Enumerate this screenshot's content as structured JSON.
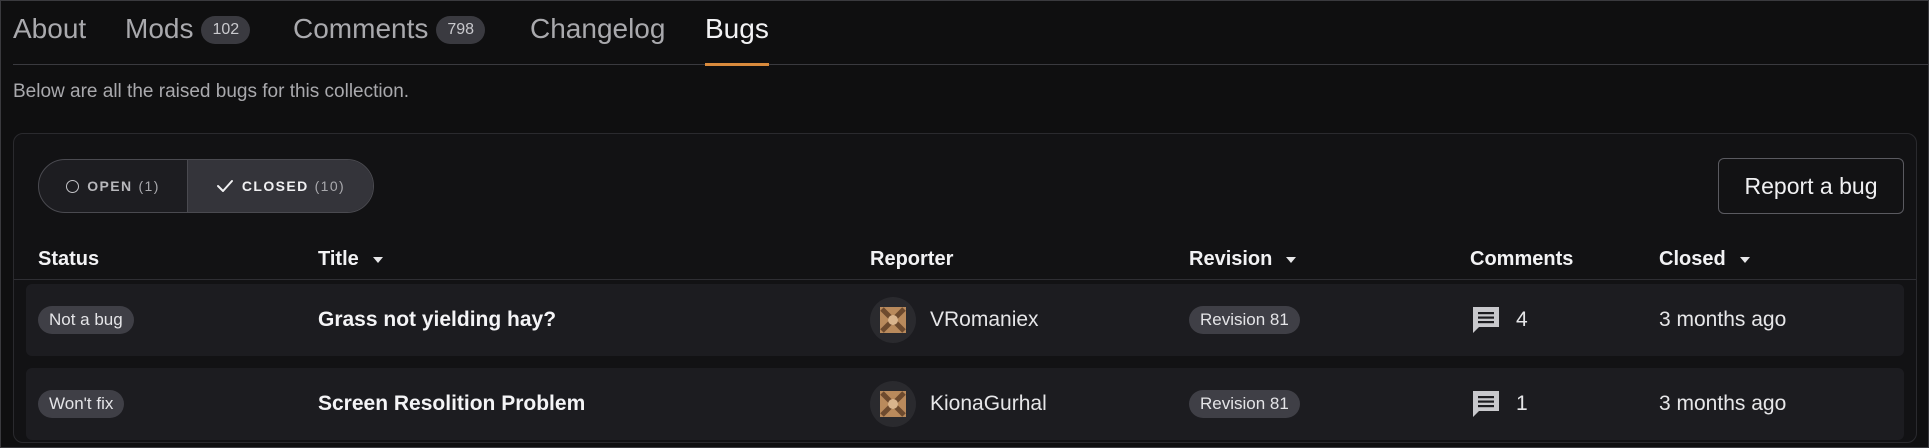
{
  "tabs": [
    {
      "label": "About",
      "count": null
    },
    {
      "label": "Mods",
      "count": "102"
    },
    {
      "label": "Comments",
      "count": "798"
    },
    {
      "label": "Changelog",
      "count": null
    },
    {
      "label": "Bugs",
      "count": null
    }
  ],
  "active_tab": "Bugs",
  "subtitle": "Below are all the raised bugs for this collection.",
  "filter": {
    "open_label": "OPEN",
    "open_count": "(1)",
    "closed_label": "CLOSED",
    "closed_count": "(10)",
    "selected": "closed"
  },
  "report_button": "Report a bug",
  "columns": {
    "status": "Status",
    "title": "Title",
    "reporter": "Reporter",
    "revision": "Revision",
    "comments": "Comments",
    "closed": "Closed"
  },
  "rows": [
    {
      "status": "Not a bug",
      "title": "Grass not yielding hay?",
      "reporter": "VRomaniex",
      "revision": "Revision 81",
      "comments": "4",
      "closed": "3 months ago"
    },
    {
      "status": "Won't fix",
      "title": "Screen Resolition Problem",
      "reporter": "KionaGurhal",
      "revision": "Revision 81",
      "comments": "1",
      "closed": "3 months ago"
    }
  ],
  "colors": {
    "accent": "#d88a3c",
    "background": "#0f0f10",
    "row": "#1c1c20",
    "badge": "#3f3f46"
  }
}
